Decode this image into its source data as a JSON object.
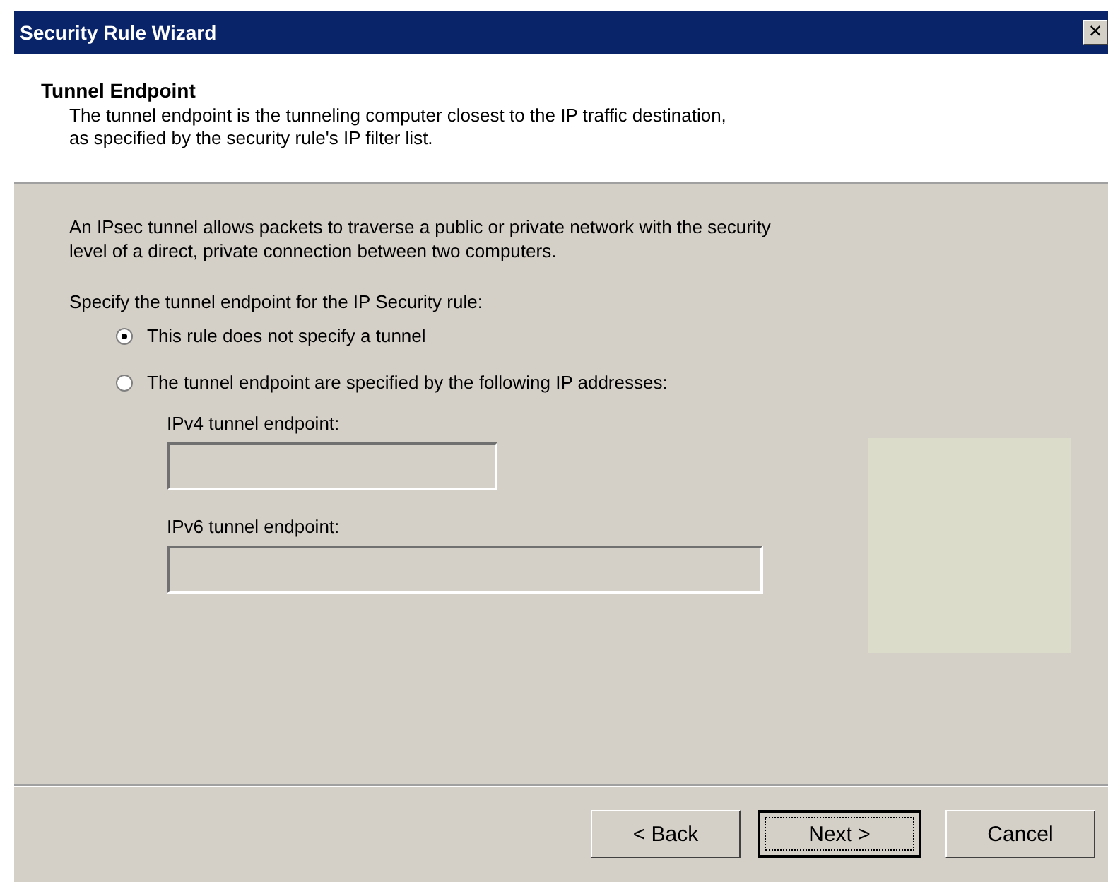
{
  "window": {
    "title": "Security Rule Wizard",
    "close": "×"
  },
  "header": {
    "title": "Tunnel Endpoint",
    "description": "The tunnel endpoint is the tunneling computer closest to the IP traffic destination,\nas specified by the security rule's IP filter list."
  },
  "intro": "An IPsec tunnel allows packets to traverse a public or private network with the security\nlevel of a direct, private connection between two computers.",
  "prompt": "Specify the tunnel endpoint for the IP Security rule:",
  "options": [
    {
      "label": "This rule does not specify a tunnel",
      "selected": true
    },
    {
      "label": "The tunnel endpoint are specified by the following IP addresses:",
      "selected": false
    }
  ],
  "fields": [
    {
      "label": "IPv4 tunnel endpoint:",
      "disabled": true
    },
    {
      "label": "IPv6 tunnel endpoint:",
      "disabled": true
    }
  ],
  "buttons": [
    {
      "label": "< Back",
      "default": false
    },
    {
      "label": "Next >",
      "default": true
    },
    {
      "label": "Cancel",
      "default": false
    }
  ]
}
